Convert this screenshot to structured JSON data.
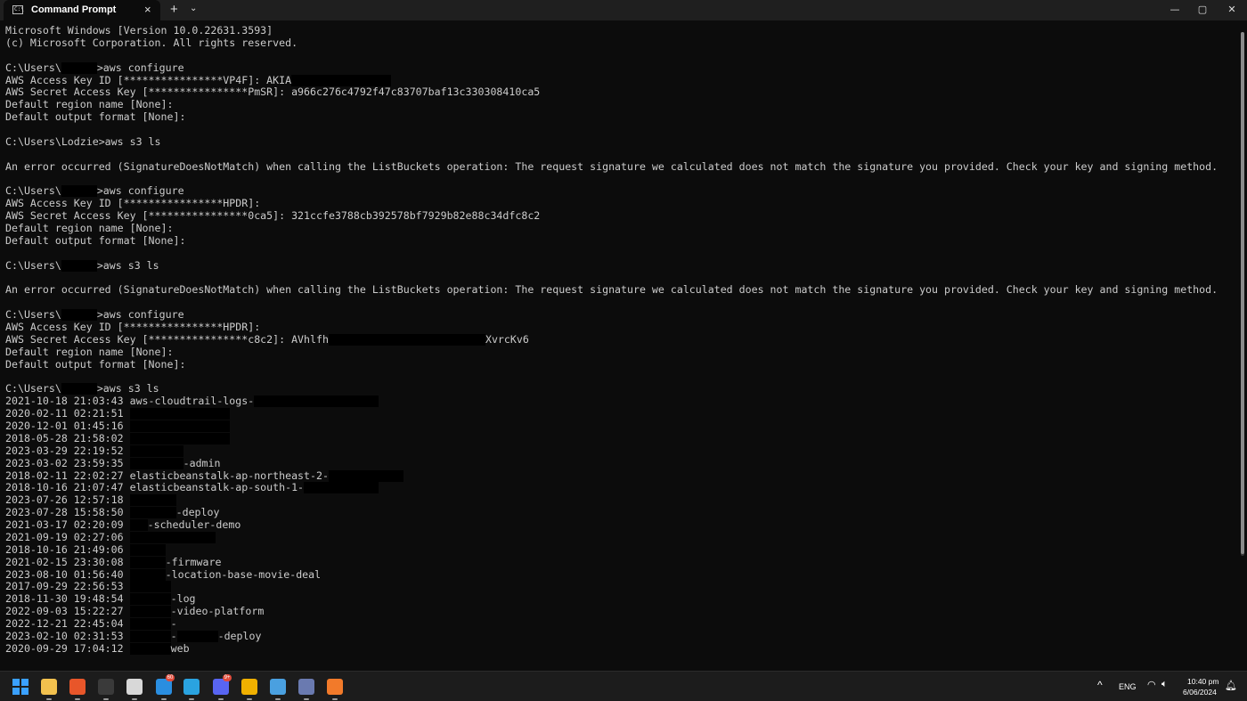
{
  "window": {
    "tab_title": "Command Prompt",
    "tab_close": "×",
    "new_tab": "+",
    "tab_dropdown": "⌄",
    "minimize": "—",
    "maximize": "▢",
    "close": "✕"
  },
  "terminal": {
    "lines": [
      {
        "segments": [
          {
            "t": "Microsoft Windows [Version 10.0.22631.3593]"
          }
        ]
      },
      {
        "segments": [
          {
            "t": "(c) Microsoft Corporation. All rights reserved."
          }
        ]
      },
      {
        "segments": [
          {
            "t": ""
          }
        ]
      },
      {
        "segments": [
          {
            "t": "C:\\Users\\"
          },
          {
            "r": 40
          },
          {
            "t": ">aws configure"
          }
        ]
      },
      {
        "segments": [
          {
            "t": "AWS Access Key ID [****************VP4F]: AKIA"
          },
          {
            "r": 112
          }
        ]
      },
      {
        "segments": [
          {
            "t": "AWS Secret Access Key [****************PmSR]: a966c276c4792f47c83707baf13c330308410ca5"
          }
        ]
      },
      {
        "segments": [
          {
            "t": "Default region name [None]:"
          }
        ]
      },
      {
        "segments": [
          {
            "t": "Default output format [None]:"
          }
        ]
      },
      {
        "segments": [
          {
            "t": ""
          }
        ]
      },
      {
        "segments": [
          {
            "t": "C:\\Users\\Lodzie>aws s3 ls"
          }
        ]
      },
      {
        "segments": [
          {
            "t": ""
          }
        ]
      },
      {
        "segments": [
          {
            "t": "An error occurred (SignatureDoesNotMatch) when calling the ListBuckets operation: The request signature we calculated does not match the signature you provided. Check your key and signing method."
          }
        ]
      },
      {
        "segments": [
          {
            "t": ""
          }
        ]
      },
      {
        "segments": [
          {
            "t": "C:\\Users\\"
          },
          {
            "r": 40
          },
          {
            "t": ">aws configure"
          }
        ]
      },
      {
        "segments": [
          {
            "t": "AWS Access Key ID [****************HPDR]:"
          }
        ]
      },
      {
        "segments": [
          {
            "t": "AWS Secret Access Key [****************0ca5]: 321ccfe3788cb392578bf7929b82e88c34dfc8c2"
          }
        ]
      },
      {
        "segments": [
          {
            "t": "Default region name [None]:"
          }
        ]
      },
      {
        "segments": [
          {
            "t": "Default output format [None]:"
          }
        ]
      },
      {
        "segments": [
          {
            "t": ""
          }
        ]
      },
      {
        "segments": [
          {
            "t": "C:\\Users\\"
          },
          {
            "r": 40
          },
          {
            "t": ">aws s3 ls"
          }
        ]
      },
      {
        "segments": [
          {
            "t": ""
          }
        ]
      },
      {
        "segments": [
          {
            "t": "An error occurred (SignatureDoesNotMatch) when calling the ListBuckets operation: The request signature we calculated does not match the signature you provided. Check your key and signing method."
          }
        ]
      },
      {
        "segments": [
          {
            "t": ""
          }
        ]
      },
      {
        "segments": [
          {
            "t": "C:\\Users\\"
          },
          {
            "r": 40
          },
          {
            "t": ">aws configure"
          }
        ]
      },
      {
        "segments": [
          {
            "t": "AWS Access Key ID [****************HPDR]:"
          }
        ]
      },
      {
        "segments": [
          {
            "t": "AWS Secret Access Key [****************c8c2]: AVhlfh"
          },
          {
            "r": 176
          },
          {
            "t": "XvrcKv6"
          }
        ]
      },
      {
        "segments": [
          {
            "t": "Default region name [None]:"
          }
        ]
      },
      {
        "segments": [
          {
            "t": "Default output format [None]:"
          }
        ]
      },
      {
        "segments": [
          {
            "t": ""
          }
        ]
      },
      {
        "segments": [
          {
            "t": "C:\\Users\\"
          },
          {
            "r": 40
          },
          {
            "t": ">aws s3 ls"
          }
        ]
      },
      {
        "segments": [
          {
            "t": "2021-10-18 21:03:43 aws-cloudtrail-logs-"
          },
          {
            "r": 140
          }
        ]
      },
      {
        "segments": [
          {
            "t": "2020-02-11 02:21:51 "
          },
          {
            "r": 112
          }
        ]
      },
      {
        "segments": [
          {
            "t": "2020-12-01 01:45:16 "
          },
          {
            "r": 112
          }
        ]
      },
      {
        "segments": [
          {
            "t": "2018-05-28 21:58:02 "
          },
          {
            "r": 112
          }
        ]
      },
      {
        "segments": [
          {
            "t": "2023-03-29 22:19:52 "
          },
          {
            "r": 60
          }
        ]
      },
      {
        "segments": [
          {
            "t": "2023-03-02 23:59:35 "
          },
          {
            "r": 60
          },
          {
            "t": "-admin"
          }
        ]
      },
      {
        "segments": [
          {
            "t": "2018-02-11 22:02:27 elasticbeanstalk-ap-northeast-2-"
          },
          {
            "r": 84
          }
        ]
      },
      {
        "segments": [
          {
            "t": "2018-10-16 21:07:47 elasticbeanstalk-ap-south-1-"
          },
          {
            "r": 84
          }
        ]
      },
      {
        "segments": [
          {
            "t": "2023-07-26 12:57:18 "
          },
          {
            "r": 52
          }
        ]
      },
      {
        "segments": [
          {
            "t": "2023-07-28 15:58:50 "
          },
          {
            "r": 52
          },
          {
            "t": "-deploy"
          }
        ]
      },
      {
        "segments": [
          {
            "t": "2021-03-17 02:20:09 "
          },
          {
            "r": 20
          },
          {
            "t": "-scheduler-demo"
          }
        ]
      },
      {
        "segments": [
          {
            "t": "2021-09-19 02:27:06 "
          },
          {
            "r": 96
          }
        ]
      },
      {
        "segments": [
          {
            "t": "2018-10-16 21:49:06 "
          },
          {
            "r": 40
          }
        ]
      },
      {
        "segments": [
          {
            "t": "2021-02-15 23:30:08 "
          },
          {
            "r": 40
          },
          {
            "t": "-firmware"
          }
        ]
      },
      {
        "segments": [
          {
            "t": "2023-08-10 01:56:40 "
          },
          {
            "r": 40
          },
          {
            "t": "-location-base-movie-deal"
          }
        ]
      },
      {
        "segments": [
          {
            "t": "2017-09-29 22:56:53 "
          },
          {
            "r": 46
          }
        ]
      },
      {
        "segments": [
          {
            "t": "2018-11-30 19:48:54 "
          },
          {
            "r": 46
          },
          {
            "t": "-log"
          }
        ]
      },
      {
        "segments": [
          {
            "t": "2022-09-03 15:22:27 "
          },
          {
            "r": 46
          },
          {
            "t": "-video-platform"
          }
        ]
      },
      {
        "segments": [
          {
            "t": "2022-12-21 22:45:04 "
          },
          {
            "r": 46
          },
          {
            "t": "-"
          }
        ]
      },
      {
        "segments": [
          {
            "t": "2023-02-10 02:31:53 "
          },
          {
            "r": 46
          },
          {
            "t": "-"
          },
          {
            "r": 46
          },
          {
            "t": "-deploy"
          }
        ]
      },
      {
        "segments": [
          {
            "t": "2020-09-29 17:04:12 "
          },
          {
            "r": 46
          },
          {
            "t": "web"
          }
        ]
      }
    ]
  },
  "taskbar": {
    "apps": [
      {
        "name": "start",
        "color": "#3aa0ff"
      },
      {
        "name": "file-explorer",
        "color": "#f2c14e"
      },
      {
        "name": "brave",
        "color": "#e8562a"
      },
      {
        "name": "terminal",
        "color": "#3a3a3a"
      },
      {
        "name": "app-mask",
        "color": "#d8d8d8"
      },
      {
        "name": "app-blue-circle",
        "color": "#2a8ee0",
        "badge": "60"
      },
      {
        "name": "telegram",
        "color": "#2aa3e0"
      },
      {
        "name": "discord",
        "color": "#5865f2",
        "badge": "9+"
      },
      {
        "name": "app-orange",
        "color": "#f0b000"
      },
      {
        "name": "vscode-like",
        "color": "#4aa0e0"
      },
      {
        "name": "network-app",
        "color": "#6a7ab0"
      },
      {
        "name": "app-gift",
        "color": "#f27a2a"
      }
    ],
    "tray": {
      "chevron": "^",
      "lang": "ENG",
      "time": "10:40 pm",
      "date": "6/06/2024"
    }
  }
}
